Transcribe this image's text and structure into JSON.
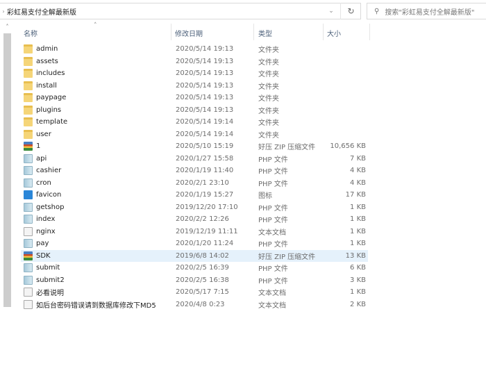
{
  "address": {
    "path": "彩虹易支付全解最新版"
  },
  "search": {
    "placeholder": "搜索\"彩虹易支付全解最新版\""
  },
  "columns": {
    "name": "名称",
    "date": "修改日期",
    "type": "类型",
    "size": "大小"
  },
  "files": [
    {
      "name": "admin",
      "date": "2020/5/14 19:13",
      "type": "文件夹",
      "size": "",
      "icon": "folder"
    },
    {
      "name": "assets",
      "date": "2020/5/14 19:13",
      "type": "文件夹",
      "size": "",
      "icon": "folder"
    },
    {
      "name": "includes",
      "date": "2020/5/14 19:13",
      "type": "文件夹",
      "size": "",
      "icon": "folder"
    },
    {
      "name": "install",
      "date": "2020/5/14 19:13",
      "type": "文件夹",
      "size": "",
      "icon": "folder"
    },
    {
      "name": "paypage",
      "date": "2020/5/14 19:13",
      "type": "文件夹",
      "size": "",
      "icon": "folder"
    },
    {
      "name": "plugins",
      "date": "2020/5/14 19:13",
      "type": "文件夹",
      "size": "",
      "icon": "folder"
    },
    {
      "name": "template",
      "date": "2020/5/14 19:14",
      "type": "文件夹",
      "size": "",
      "icon": "folder"
    },
    {
      "name": "user",
      "date": "2020/5/14 19:14",
      "type": "文件夹",
      "size": "",
      "icon": "folder"
    },
    {
      "name": "1",
      "date": "2020/5/10 15:19",
      "type": "好压 ZIP 压缩文件",
      "size": "10,656 KB",
      "icon": "zip"
    },
    {
      "name": "api",
      "date": "2020/1/27 15:58",
      "type": "PHP 文件",
      "size": "7 KB",
      "icon": "php"
    },
    {
      "name": "cashier",
      "date": "2020/1/19 11:40",
      "type": "PHP 文件",
      "size": "4 KB",
      "icon": "php"
    },
    {
      "name": "cron",
      "date": "2020/2/1 23:10",
      "type": "PHP 文件",
      "size": "4 KB",
      "icon": "php"
    },
    {
      "name": "favicon",
      "date": "2020/1/19 15:27",
      "type": "图标",
      "size": "17 KB",
      "icon": "ico"
    },
    {
      "name": "getshop",
      "date": "2019/12/20 17:10",
      "type": "PHP 文件",
      "size": "1 KB",
      "icon": "php"
    },
    {
      "name": "index",
      "date": "2020/2/2 12:26",
      "type": "PHP 文件",
      "size": "1 KB",
      "icon": "php"
    },
    {
      "name": "nginx",
      "date": "2019/12/19 11:11",
      "type": "文本文档",
      "size": "1 KB",
      "icon": "txt"
    },
    {
      "name": "pay",
      "date": "2020/1/20 11:24",
      "type": "PHP 文件",
      "size": "1 KB",
      "icon": "php"
    },
    {
      "name": "SDK",
      "date": "2019/6/8 14:02",
      "type": "好压 ZIP 压缩文件",
      "size": "13 KB",
      "icon": "zip",
      "selected": true
    },
    {
      "name": "submit",
      "date": "2020/2/5 16:39",
      "type": "PHP 文件",
      "size": "6 KB",
      "icon": "php"
    },
    {
      "name": "submit2",
      "date": "2020/2/5 16:38",
      "type": "PHP 文件",
      "size": "3 KB",
      "icon": "php"
    },
    {
      "name": "必看说明",
      "date": "2020/5/17 7:15",
      "type": "文本文档",
      "size": "1 KB",
      "icon": "txt"
    },
    {
      "name": "如后台密码错误请到数据库修改下MD5",
      "date": "2020/4/8 0:23",
      "type": "文本文档",
      "size": "2 KB",
      "icon": "txt"
    }
  ]
}
